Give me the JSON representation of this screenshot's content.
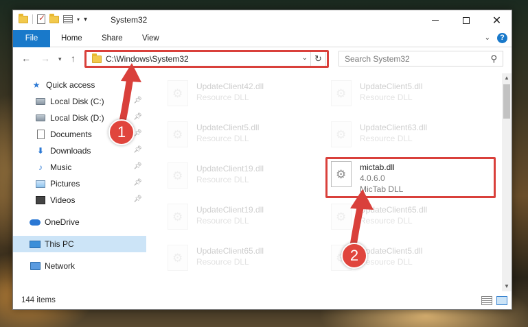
{
  "window": {
    "title": "System32",
    "qat": [
      "folder-icon",
      "properties-icon",
      "new-folder-icon",
      "customize-icon"
    ]
  },
  "ribbon": {
    "tabs": [
      "File",
      "Home",
      "Share",
      "View"
    ]
  },
  "nav": {
    "address": "C:\\Windows\\System32",
    "search_placeholder": "Search System32"
  },
  "sidebar": {
    "items": [
      {
        "label": "Quick access",
        "icon": "star-icon",
        "pinned": false
      },
      {
        "label": "Local Disk (C:)",
        "icon": "drive-icon",
        "pinned": true
      },
      {
        "label": "Local Disk (D:)",
        "icon": "drive-icon",
        "pinned": true
      },
      {
        "label": "Documents",
        "icon": "documents-icon",
        "pinned": true
      },
      {
        "label": "Downloads",
        "icon": "downloads-icon",
        "pinned": true
      },
      {
        "label": "Music",
        "icon": "music-icon",
        "pinned": true
      },
      {
        "label": "Pictures",
        "icon": "pictures-icon",
        "pinned": true
      },
      {
        "label": "Videos",
        "icon": "videos-icon",
        "pinned": true
      },
      {
        "label": "OneDrive",
        "icon": "onedrive-icon",
        "pinned": false
      },
      {
        "label": "This PC",
        "icon": "this-pc-icon",
        "pinned": false,
        "selected": true
      },
      {
        "label": "Network",
        "icon": "network-icon",
        "pinned": false
      }
    ]
  },
  "files": [
    {
      "name": "UpdateClient42.dll",
      "desc": "Resource DLL"
    },
    {
      "name": "UpdateClient5.dll",
      "desc": "Resource DLL"
    },
    {
      "name": "UpdateClient5.dll",
      "desc": "Resource DLL"
    },
    {
      "name": "UpdateClient63.dll",
      "desc": "Resource DLL"
    },
    {
      "name": "UpdateClient19.dll",
      "desc": "Resource DLL"
    },
    {
      "name": "mictab.dll",
      "version": "4.0.6.0",
      "desc": "MicTab DLL"
    },
    {
      "name": "UpdateClient19.dll",
      "desc": "Resource DLL"
    },
    {
      "name": "UpdateClient65.dll",
      "desc": "Resource DLL"
    },
    {
      "name": "UpdateClient65.dll",
      "desc": "Resource DLL"
    },
    {
      "name": "UpdateClient5.dll",
      "desc": "Resource DLL"
    }
  ],
  "status": {
    "item_count": "144 items"
  },
  "markers": [
    "1",
    "2"
  ],
  "colors": {
    "accent": "#1979ca",
    "highlight": "#d9403b",
    "selected": "#cce4f7"
  }
}
